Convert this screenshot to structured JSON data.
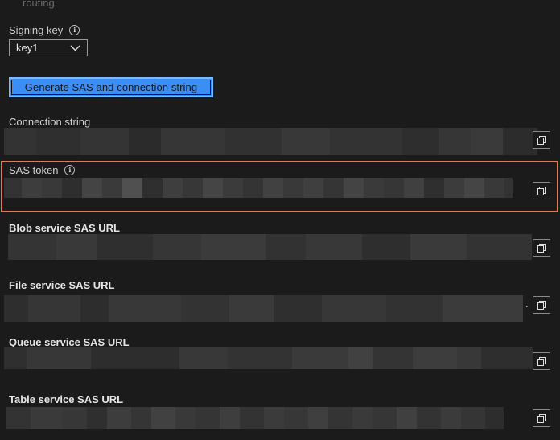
{
  "top_text": "routing.",
  "signing_key": {
    "label": "Signing key",
    "info_icon": "info-icon",
    "selected": "key1"
  },
  "generate_button": "Generate SAS and connection string",
  "fields": {
    "connection_string": "Connection string",
    "sas_token": "SAS token",
    "blob_url": "Blob service SAS URL",
    "file_url": "File service SAS URL",
    "queue_url": "Queue service SAS URL",
    "table_url": "Table service SAS URL"
  },
  "colors": {
    "background": "#1b1b1b",
    "button": "#3a8ef6",
    "highlight": "#e07a57"
  }
}
